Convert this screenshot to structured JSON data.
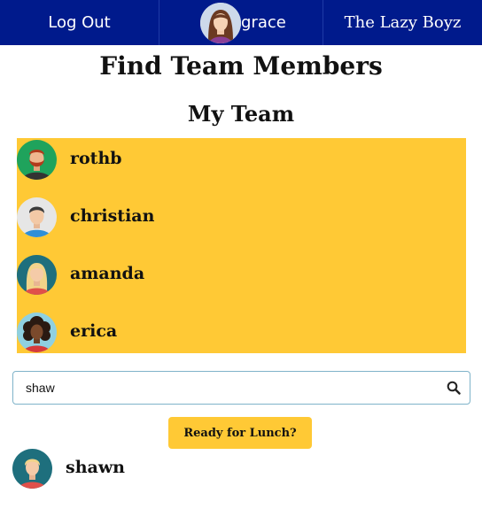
{
  "nav": {
    "logout_label": "Log Out",
    "username": "grace",
    "team_name": "The Lazy Boyz"
  },
  "page_title": "Find Team Members",
  "team_section_title": "My Team",
  "team_members": [
    {
      "name": "rothb",
      "avatar": "bearded-man-avatar"
    },
    {
      "name": "christian",
      "avatar": "man-avatar"
    },
    {
      "name": "amanda",
      "avatar": "blonde-woman-avatar"
    },
    {
      "name": "erica",
      "avatar": "curly-hair-woman-avatar"
    }
  ],
  "search": {
    "value": "shaw"
  },
  "lunch_button_label": "Ready for Lunch?",
  "search_results": [
    {
      "name": "shawn",
      "avatar": "blonde-man-avatar"
    }
  ],
  "colors": {
    "nav_bg": "#001a8c",
    "accent_yellow": "#ffc935"
  }
}
